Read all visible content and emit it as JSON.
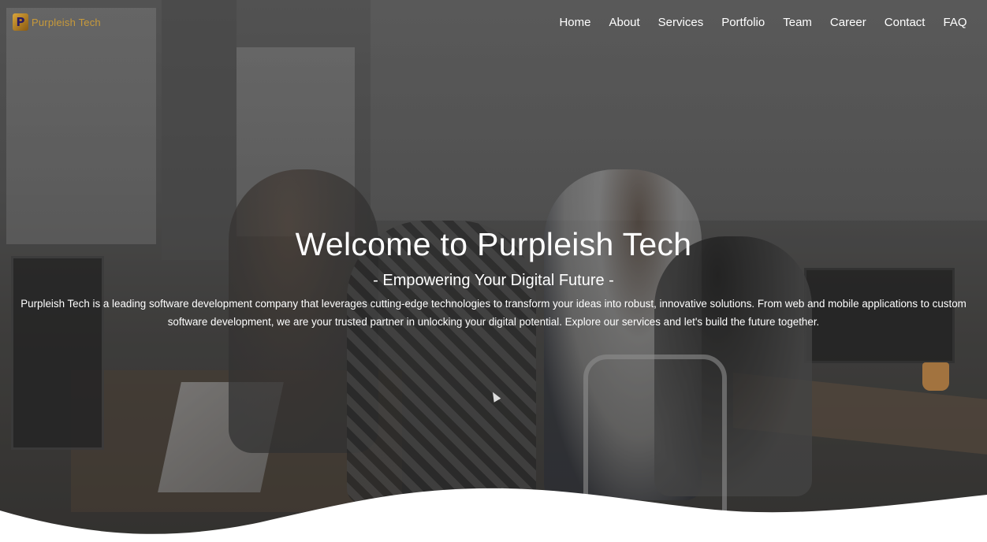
{
  "brand": {
    "logo_letter": "P",
    "name": "Purpleish Tech"
  },
  "nav": {
    "items": [
      {
        "label": "Home"
      },
      {
        "label": "About"
      },
      {
        "label": "Services"
      },
      {
        "label": "Portfolio"
      },
      {
        "label": "Team"
      },
      {
        "label": "Career"
      },
      {
        "label": "Contact"
      },
      {
        "label": "FAQ"
      }
    ]
  },
  "hero": {
    "title": "Welcome to Purpleish Tech",
    "subtitle": "- Empowering Your Digital Future -",
    "description": "Purpleish Tech is a leading software development company that leverages cutting-edge technologies to transform your ideas into robust, innovative solutions. From web and mobile applications to custom software development, we are your trusted partner in unlocking your digital potential. Explore our services and let's build the future together."
  },
  "colors": {
    "brand_gold": "#c89a3a",
    "text_white": "#ffffff"
  }
}
